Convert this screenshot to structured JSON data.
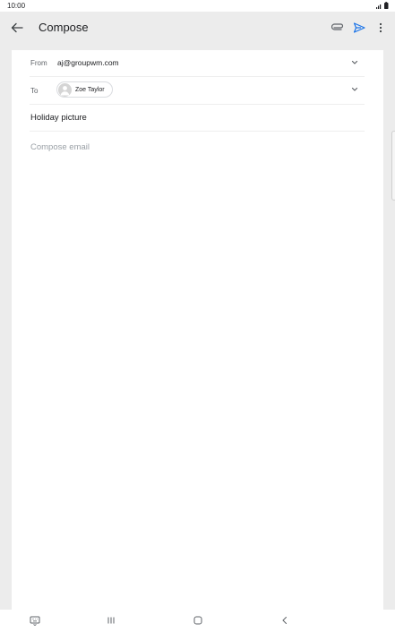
{
  "status_bar": {
    "time": "10:00"
  },
  "app_bar": {
    "title": "Compose",
    "accent_color": "#1a73e8",
    "icons": [
      "back-arrow-icon",
      "attach-icon",
      "send-icon",
      "more-vert-icon"
    ]
  },
  "compose": {
    "from_label": "From",
    "from_value": "aj@groupwm.com",
    "to_label": "To",
    "recipient_name": "Zoe Taylor",
    "subject": "Holiday picture",
    "body_placeholder": "Compose email"
  },
  "nav_bar": {
    "icons": [
      "keyboard-icon",
      "recents-icon",
      "home-icon",
      "back-icon"
    ]
  }
}
